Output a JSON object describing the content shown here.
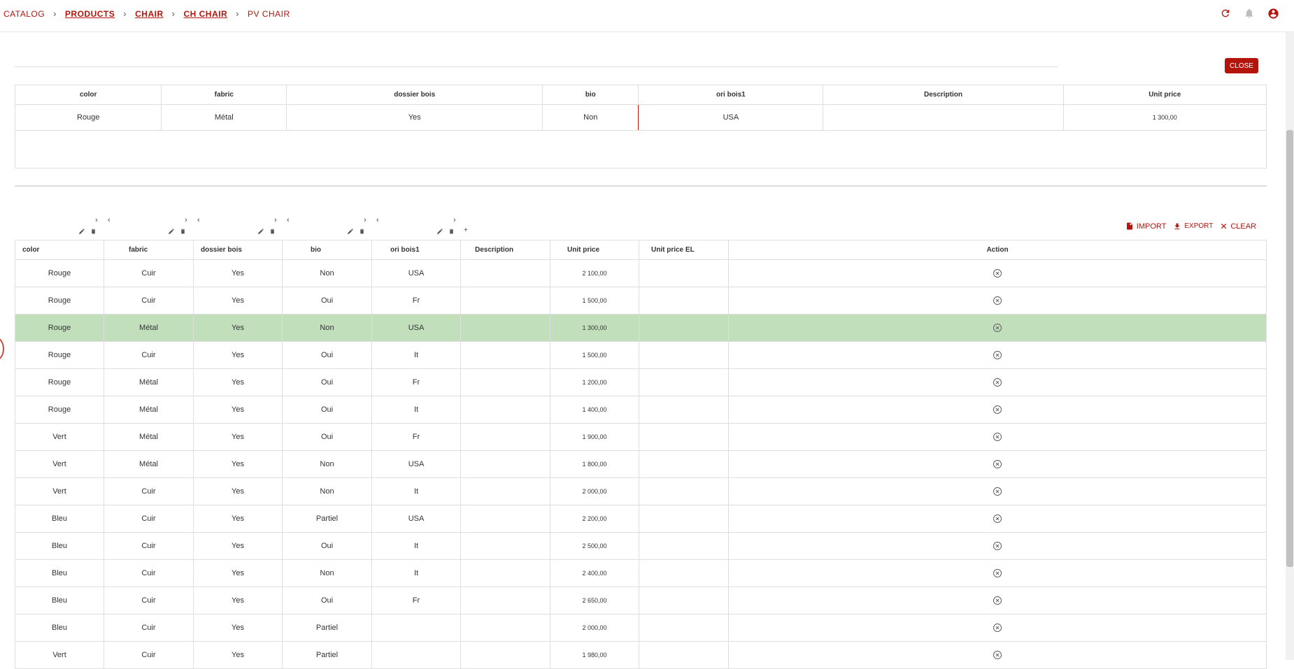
{
  "breadcrumb": [
    {
      "label": "CATALOG",
      "link": false
    },
    {
      "label": "PRODUCTS",
      "link": true
    },
    {
      "label": "CHAIR",
      "link": true
    },
    {
      "label": "CH CHAIR",
      "link": true
    },
    {
      "label": "PV CHAIR",
      "link": false
    }
  ],
  "breadcrumb_sep": "›",
  "header_icons": [
    "refresh-icon",
    "bell-icon",
    "account-icon"
  ],
  "close_label": "CLOSE",
  "selected_table": {
    "headers": [
      "color",
      "fabric",
      "dossier bois",
      "bio",
      "ori bois1",
      "Description",
      "Unit price"
    ],
    "row": [
      "Rouge",
      "Métal",
      "Yes",
      "Non",
      "USA",
      "",
      "1 300,00"
    ]
  },
  "toolbar": {
    "import_label": "IMPORT",
    "export_label": "EXPORT",
    "clear_label": "CLEAR"
  },
  "column_controls": {
    "right_arrow": "›",
    "left_arrow": "‹",
    "add": "+"
  },
  "variants_table": {
    "headers": [
      "color",
      "fabric",
      "dossier bois",
      "bio",
      "ori bois1",
      "Description",
      "Unit price",
      "Unit price EL",
      "Action"
    ],
    "highlighted_row": 2,
    "rows": [
      [
        "Rouge",
        "Cuir",
        "Yes",
        "Non",
        "USA",
        "",
        "2 100,00",
        ""
      ],
      [
        "Rouge",
        "Cuir",
        "Yes",
        "Oui",
        "Fr",
        "",
        "1 500,00",
        ""
      ],
      [
        "Rouge",
        "Métal",
        "Yes",
        "Non",
        "USA",
        "",
        "1 300,00",
        ""
      ],
      [
        "Rouge",
        "Cuir",
        "Yes",
        "Oui",
        "It",
        "",
        "1 500,00",
        ""
      ],
      [
        "Rouge",
        "Métal",
        "Yes",
        "Oui",
        "Fr",
        "",
        "1 200,00",
        ""
      ],
      [
        "Rouge",
        "Métal",
        "Yes",
        "Oui",
        "It",
        "",
        "1 400,00",
        ""
      ],
      [
        "Vert",
        "Métal",
        "Yes",
        "Oui",
        "Fr",
        "",
        "1 900,00",
        ""
      ],
      [
        "Vert",
        "Métal",
        "Yes",
        "Non",
        "USA",
        "",
        "1 800,00",
        ""
      ],
      [
        "Vert",
        "Cuir",
        "Yes",
        "Non",
        "It",
        "",
        "2 000,00",
        ""
      ],
      [
        "Bleu",
        "Cuir",
        "Yes",
        "Partiel",
        "USA",
        "",
        "2 200,00",
        ""
      ],
      [
        "Bleu",
        "Cuir",
        "Yes",
        "Oui",
        "It",
        "",
        "2 500,00",
        ""
      ],
      [
        "Bleu",
        "Cuir",
        "Yes",
        "Non",
        "It",
        "",
        "2 400,00",
        ""
      ],
      [
        "Bleu",
        "Cuir",
        "Yes",
        "Oui",
        "Fr",
        "",
        "2 650,00",
        ""
      ],
      [
        "Bleu",
        "Cuir",
        "Yes",
        "Partiel",
        "",
        "",
        "2 000,00",
        ""
      ],
      [
        "Vert",
        "Cuir",
        "Yes",
        "Partiel",
        "",
        "",
        "1 980,00",
        ""
      ]
    ]
  },
  "colors": {
    "accent": "#b3140c",
    "highlight_row": "#c1dfbb",
    "border": "#dedede"
  }
}
